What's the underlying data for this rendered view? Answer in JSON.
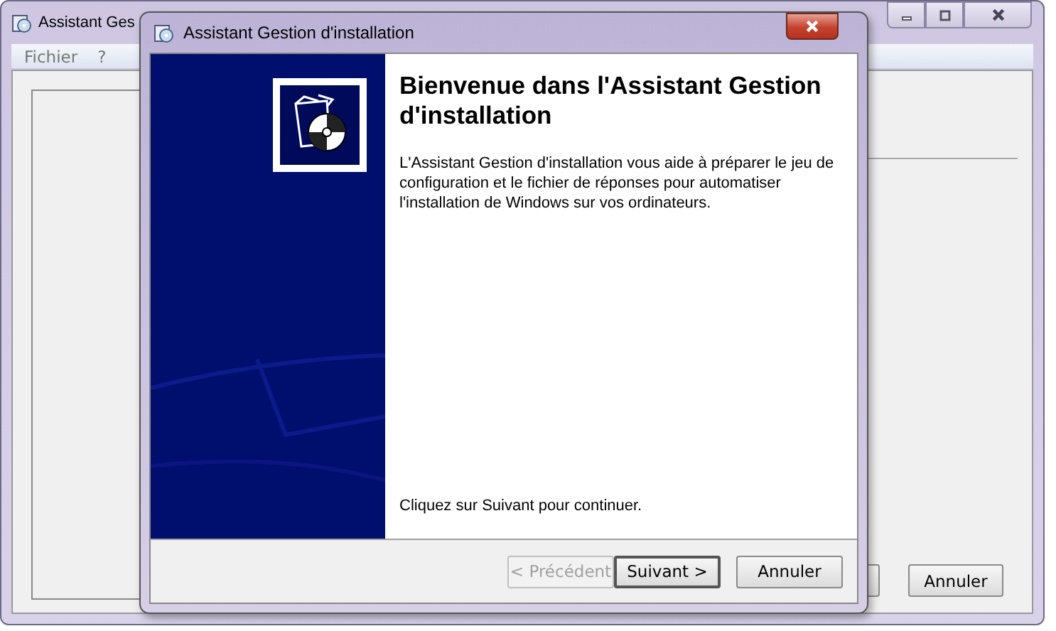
{
  "background_window": {
    "title": "Assistant Ges",
    "menu": [
      "Fichier",
      "?"
    ],
    "buttons": [
      "Annuler"
    ]
  },
  "dialog": {
    "title": "Assistant Gestion d'installation",
    "heading": "Bienvenue dans l'Assistant Gestion d'installation",
    "description": "L'Assistant Gestion d'installation vous aide à préparer le jeu de configuration et le fichier de réponses pour automatiser l'installation de Windows sur vos ordinateurs.",
    "prompt": "Cliquez sur Suivant pour continuer.",
    "buttons": [
      {
        "label": "< Précédent",
        "disabled": true,
        "default": false
      },
      {
        "label": "Suivant >",
        "disabled": false,
        "default": true
      },
      {
        "label": "Annuler",
        "disabled": false,
        "default": false
      }
    ]
  }
}
